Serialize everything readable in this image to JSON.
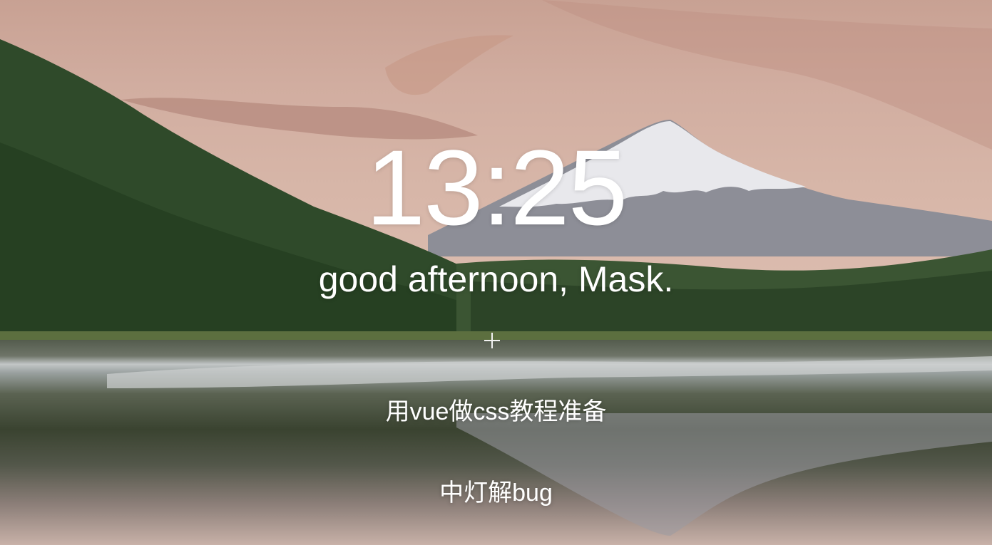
{
  "clock": {
    "time": "13:25"
  },
  "greeting": {
    "text": "good afternoon, Mask."
  },
  "add_button": {
    "icon": "plus-icon"
  },
  "todos": [
    {
      "text": "用vue做css教程准备"
    },
    {
      "text": "中灯解bug"
    }
  ],
  "background": {
    "sky_color": "#d1ada0",
    "forest_color": "#2f4a2a",
    "snow_color": "#e8e8ec",
    "mountain_shadow": "#8d8e97",
    "lake_color": "#5b6352"
  }
}
